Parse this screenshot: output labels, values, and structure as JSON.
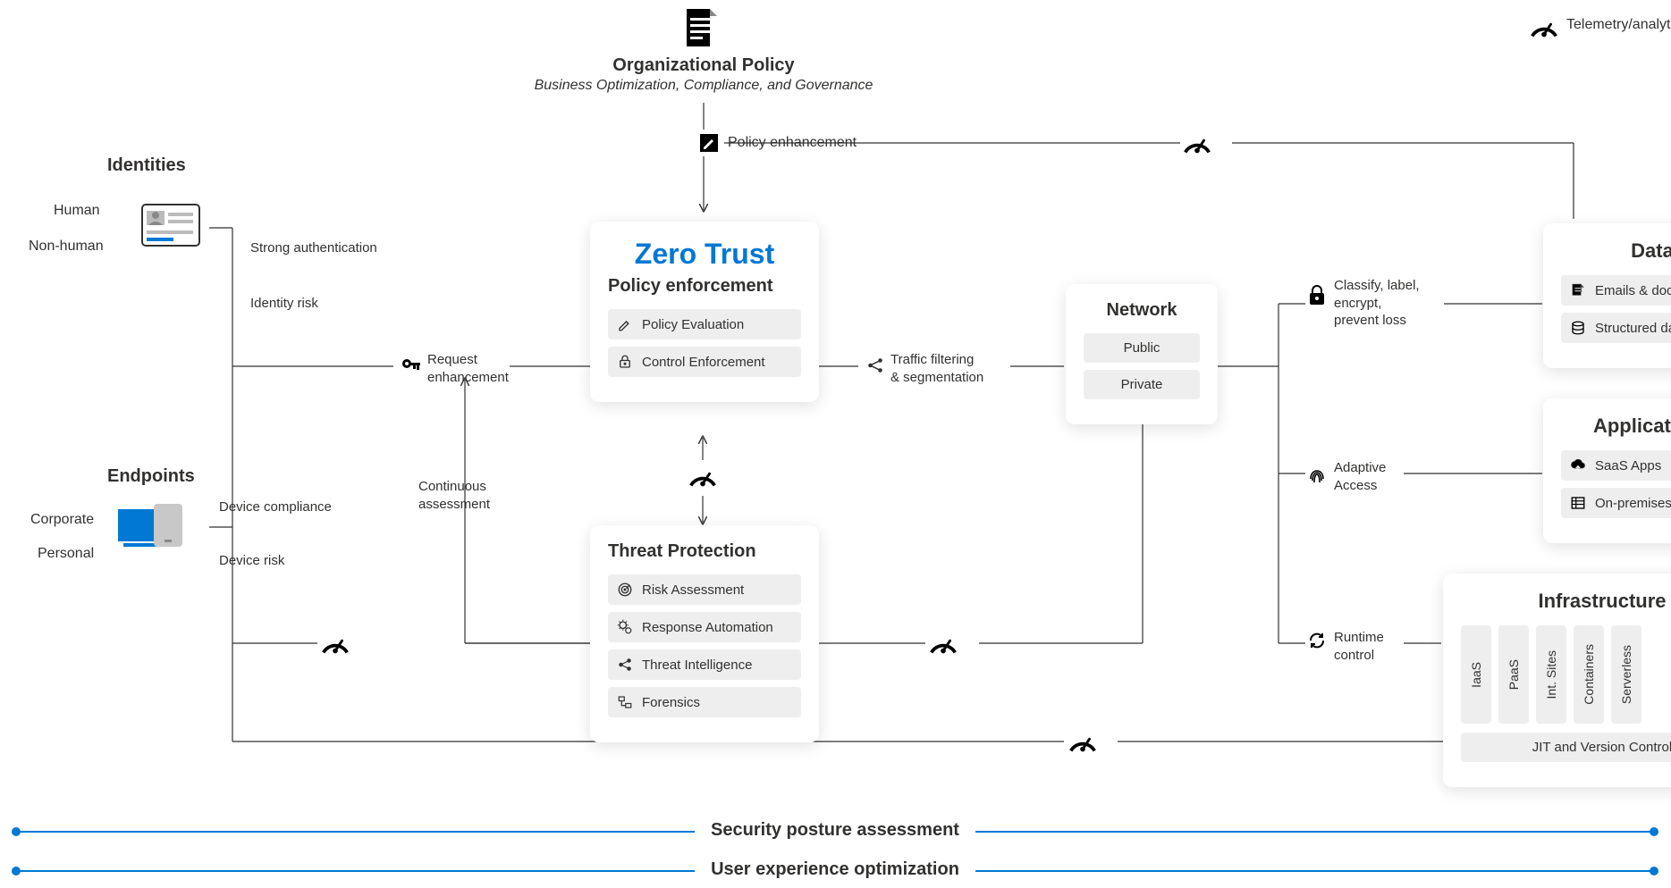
{
  "legend": {
    "telemetry": "Telemetry/analytics/assessment"
  },
  "top": {
    "title": "Organizational Policy",
    "subtitle": "Business Optimization, Compliance, and Governance",
    "policy_enhancement": "Policy enhancement"
  },
  "identities": {
    "title": "Identities",
    "human": "Human",
    "nonhuman": "Non-human",
    "strong_auth": "Strong authentication",
    "identity_risk": "Identity risk"
  },
  "endpoints": {
    "title": "Endpoints",
    "corporate": "Corporate",
    "personal": "Personal",
    "device_compliance": "Device compliance",
    "device_risk": "Device risk"
  },
  "request_enh": "Request\nenhancement",
  "cont_assess": "Continuous\nassessment",
  "zero_trust": {
    "title": "Zero Trust",
    "subtitle": "Policy enforcement",
    "items": [
      "Policy Evaluation",
      "Control Enforcement"
    ]
  },
  "threat": {
    "title": "Threat Protection",
    "items": [
      "Risk Assessment",
      "Response Automation",
      "Threat Intelligence",
      "Forensics"
    ]
  },
  "traffic": "Traffic filtering\n& segmentation",
  "network": {
    "title": "Network",
    "items": [
      "Public",
      "Private"
    ]
  },
  "right_labels": {
    "classify": "Classify, label,\nencrypt,\nprevent loss",
    "adaptive": "Adaptive\nAccess",
    "runtime": "Runtime\ncontrol"
  },
  "data": {
    "title": "Data",
    "items": [
      "Emails & documents",
      "Structured data"
    ]
  },
  "apps": {
    "title": "Applications",
    "items": [
      "SaaS Apps",
      "On-premises Apps"
    ]
  },
  "infra": {
    "title": "Infrastructure",
    "vitems": [
      "IaaS",
      "PaaS",
      "Int. Sites",
      "Containers",
      "Serverless"
    ],
    "jit": "JIT and Version Control"
  },
  "bottom": {
    "posture": "Security posture assessment",
    "ux": "User experience optimization"
  }
}
